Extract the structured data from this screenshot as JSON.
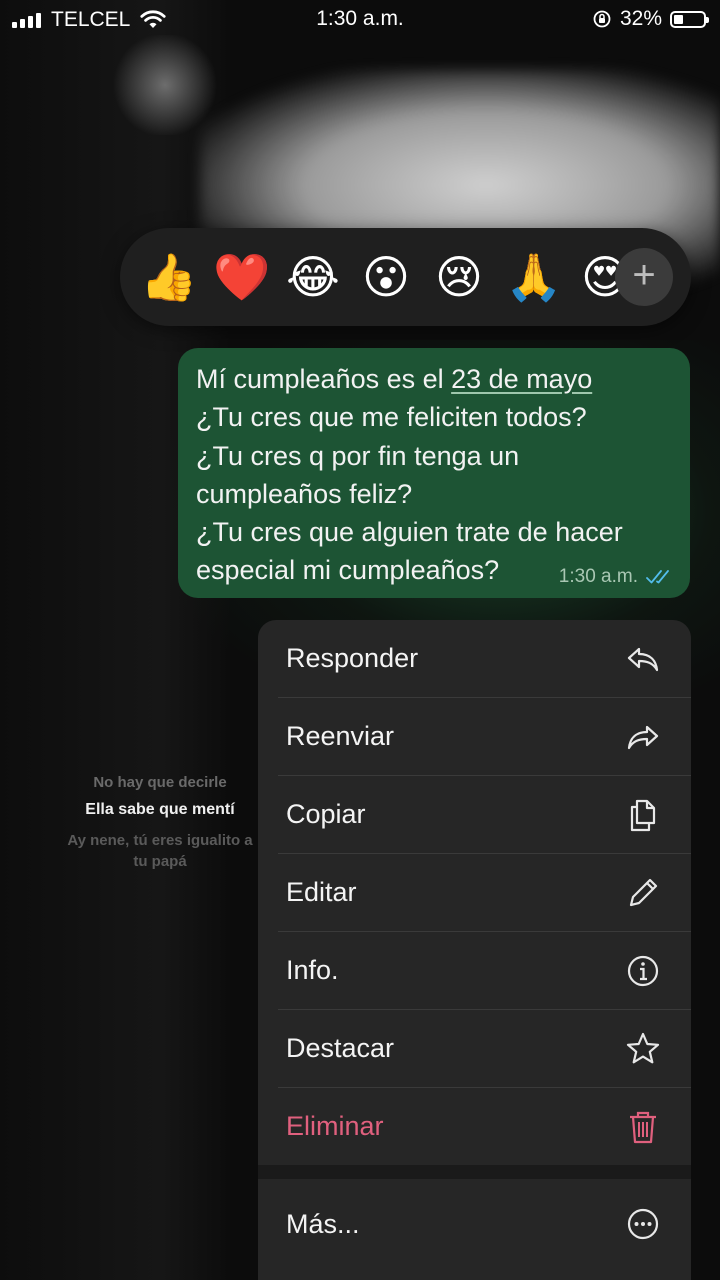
{
  "status_bar": {
    "carrier": "TELCEL",
    "time": "1:30 a.m.",
    "battery": "32%",
    "battery_level": 0.32
  },
  "reactions": [
    {
      "emoji": "👍",
      "name": "thumbs-up"
    },
    {
      "emoji": "❤️",
      "name": "red-heart"
    },
    {
      "emoji": "😂",
      "name": "tears-of-joy"
    },
    {
      "emoji": "😮",
      "name": "open-mouth"
    },
    {
      "emoji": "😢",
      "name": "crying-face"
    },
    {
      "emoji": "🙏",
      "name": "folded-hands"
    },
    {
      "emoji": "😍",
      "name": "heart-eyes"
    }
  ],
  "reaction_more": "+",
  "message": {
    "line1_prefix": "Mí cumpleaños es el ",
    "line1_date": "23 de mayo",
    "line2": "¿Tu cres que me feliciten todos?",
    "line3": "¿Tu cres q por fin tenga un",
    "line4": "cumpleaños feliz?",
    "line5": "¿Tu cres que alguien trate de hacer",
    "line6": "especial mi cumpleaños?",
    "time": "1:30 a.m.",
    "status": "read"
  },
  "background_text": {
    "line1": "No hay que decirle",
    "line2": "Ella sabe que mentí",
    "line3a": "Ay nene, tú eres igualito a",
    "line3b": "tu papá"
  },
  "menu": {
    "items": [
      {
        "label": "Responder",
        "icon": "reply-icon"
      },
      {
        "label": "Reenviar",
        "icon": "forward-icon"
      },
      {
        "label": "Copiar",
        "icon": "copy-icon"
      },
      {
        "label": "Editar",
        "icon": "pencil-icon"
      },
      {
        "label": "Info.",
        "icon": "info-icon"
      },
      {
        "label": "Destacar",
        "icon": "star-icon"
      },
      {
        "label": "Eliminar",
        "icon": "trash-icon"
      },
      {
        "label": "Más...",
        "icon": "more-icon"
      }
    ]
  },
  "colors": {
    "bubble": "#1d5434",
    "danger": "#e0607e",
    "menu_bg": "#262626",
    "read_ticks": "#53bdeb"
  }
}
